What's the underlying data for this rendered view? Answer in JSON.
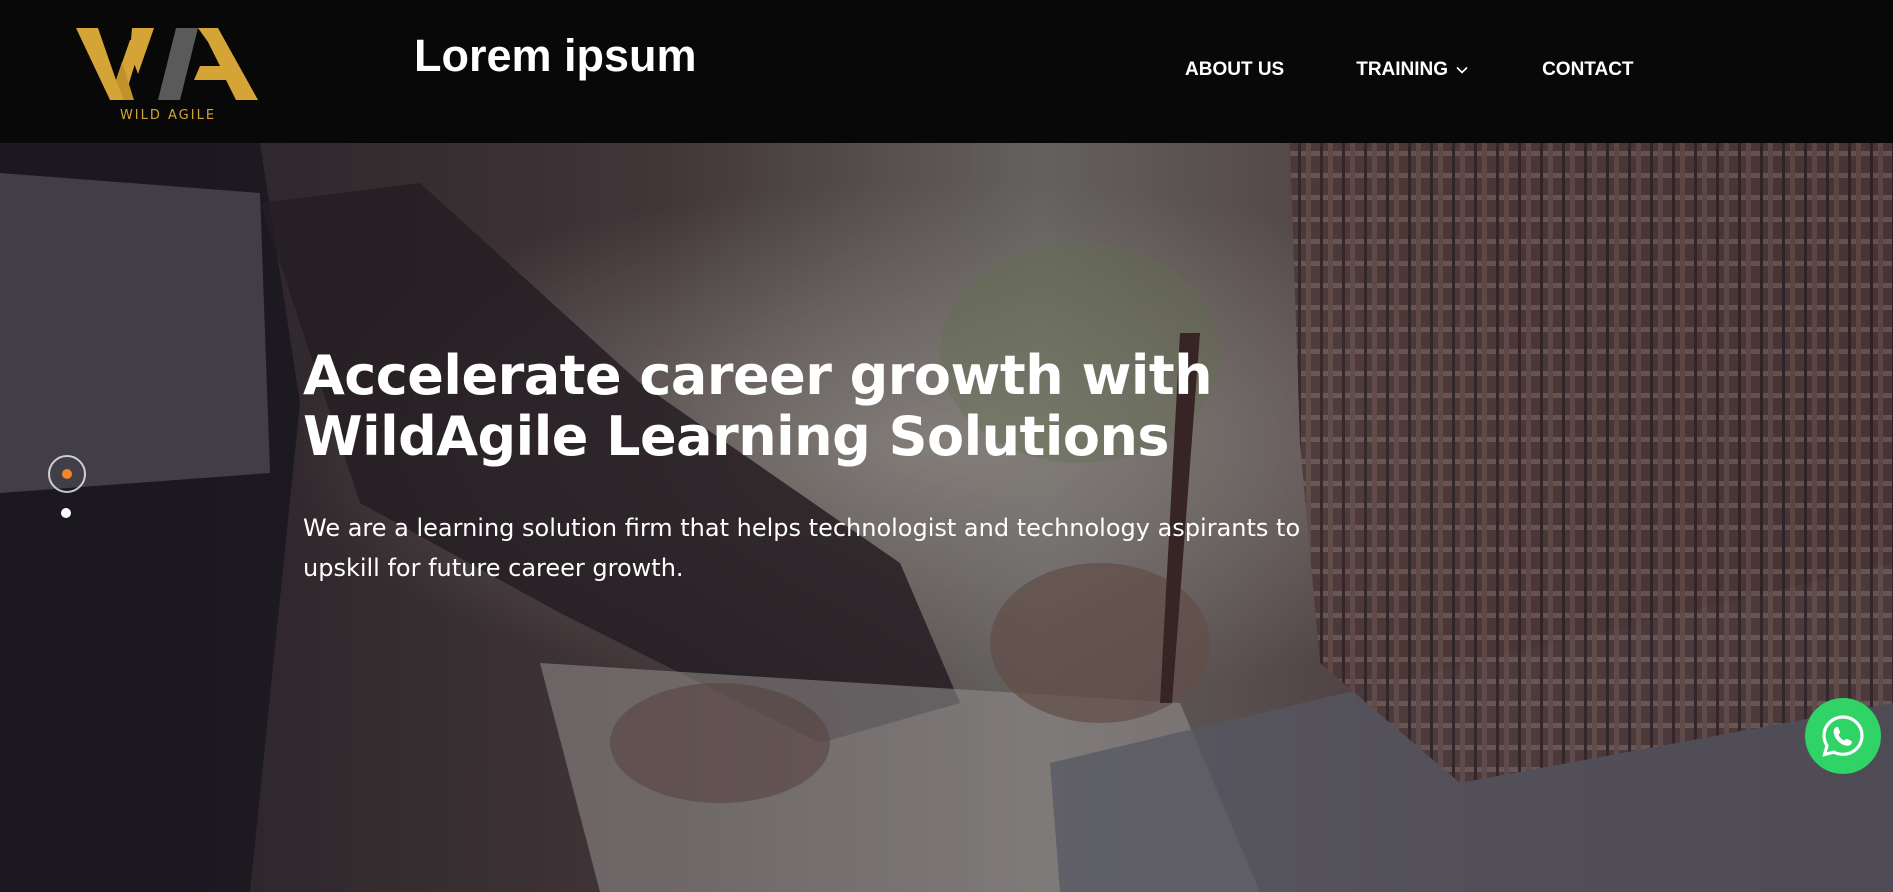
{
  "brand": {
    "logo_mark": "WA",
    "logo_tagline": "WILD AGILE",
    "site_title": "Lorem ipsum",
    "gold": "#d4a437",
    "gray": "#5a5a5a"
  },
  "nav": {
    "items": [
      {
        "label": "ABOUT US"
      },
      {
        "label": "TRAINING",
        "icon": "chevron-down-icon"
      },
      {
        "label": "CONTACT"
      }
    ]
  },
  "hero": {
    "title_line1": "Accelerate career growth with",
    "title_line2": "WildAgile Learning Solutions",
    "text_line1": "We are a learning solution firm that helps technologist and technology aspirants to",
    "text_line2": "upskill for future career growth.",
    "slider": {
      "active_color": "#f0852d"
    }
  },
  "floating": {
    "whatsapp_icon": "whatsapp-icon",
    "whatsapp_color": "#2fd366"
  }
}
